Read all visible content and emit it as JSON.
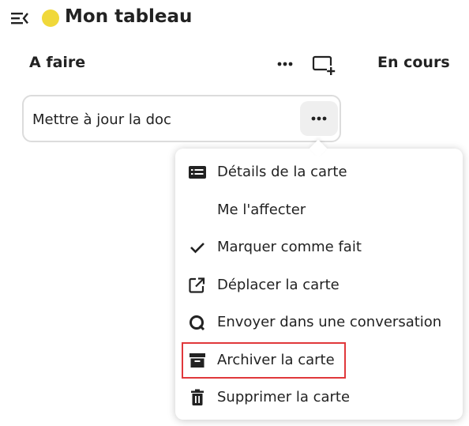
{
  "header": {
    "board_title": "Mon tableau",
    "board_color": "#f0d83a",
    "menu_toggle_icon": "menu-collapse-icon"
  },
  "columns": [
    {
      "title": "A faire"
    },
    {
      "title": "En cours"
    }
  ],
  "column_actions": {
    "more_icon": "dots-horizontal-icon",
    "add_card_icon": "card-plus-icon"
  },
  "card": {
    "title": "Mettre à jour la doc",
    "more_icon": "dots-horizontal-icon"
  },
  "card_menu": {
    "items": [
      {
        "label": "Détails de la carte",
        "icon": "card-text-icon"
      },
      {
        "label": "Me l'affecter",
        "icon": ""
      },
      {
        "label": "Marquer comme fait",
        "icon": "check-icon"
      },
      {
        "label": "Déplacer la carte",
        "icon": "open-in-new-icon"
      },
      {
        "label": "Envoyer dans une conversation",
        "icon": "talk-icon"
      },
      {
        "label": "Archiver la carte",
        "icon": "archive-icon"
      },
      {
        "label": "Supprimer la carte",
        "icon": "delete-icon"
      }
    ]
  },
  "colors": {
    "highlight": "#e0383b",
    "text": "#222222",
    "card_border": "#dcdcdc"
  }
}
